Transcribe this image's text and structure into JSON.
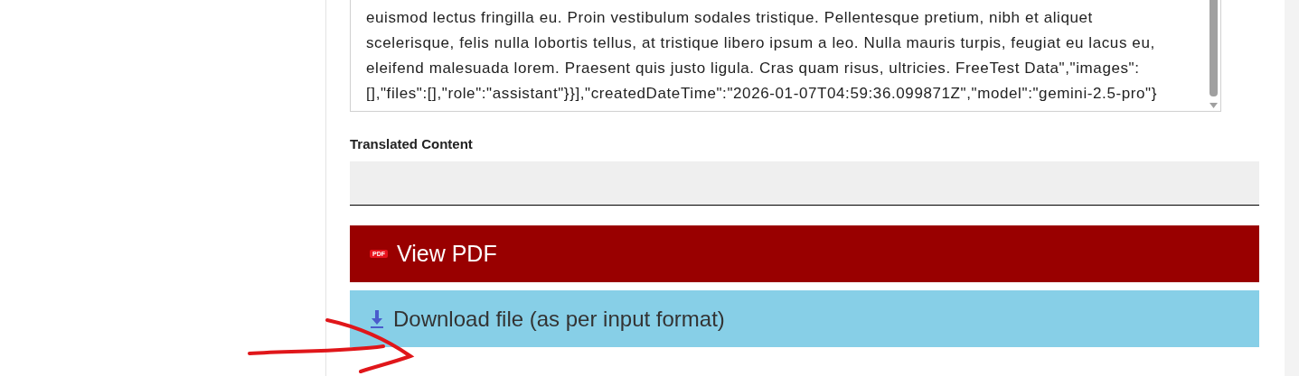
{
  "content_field": {
    "lines": [
      "euismod lectus fringilla eu. Proin vestibulum sodales tristique. Pellentesque pretium, nibh et aliquet",
      "scelerisque, felis nulla lobortis tellus, at tristique libero ipsum a leo. Nulla mauris turpis, feugiat eu lacus eu,",
      "eleifend malesuada lorem. Praesent quis justo ligula. Cras quam risus, ultricies. FreeTest Data\",\"images\":",
      "[],\"files\":[],\"role\":\"assistant\"}}],\"createdDateTime\":\"2026-01-07T04:59:36.099871Z\",\"model\":\"gemini-2.5-pro\"}"
    ]
  },
  "translated_content": {
    "label": "Translated Content"
  },
  "buttons": [
    {
      "kind": "pdf",
      "label": "View PDF",
      "badge": "PDF"
    },
    {
      "kind": "download",
      "label": "Download file (as per input format)"
    }
  ]
}
